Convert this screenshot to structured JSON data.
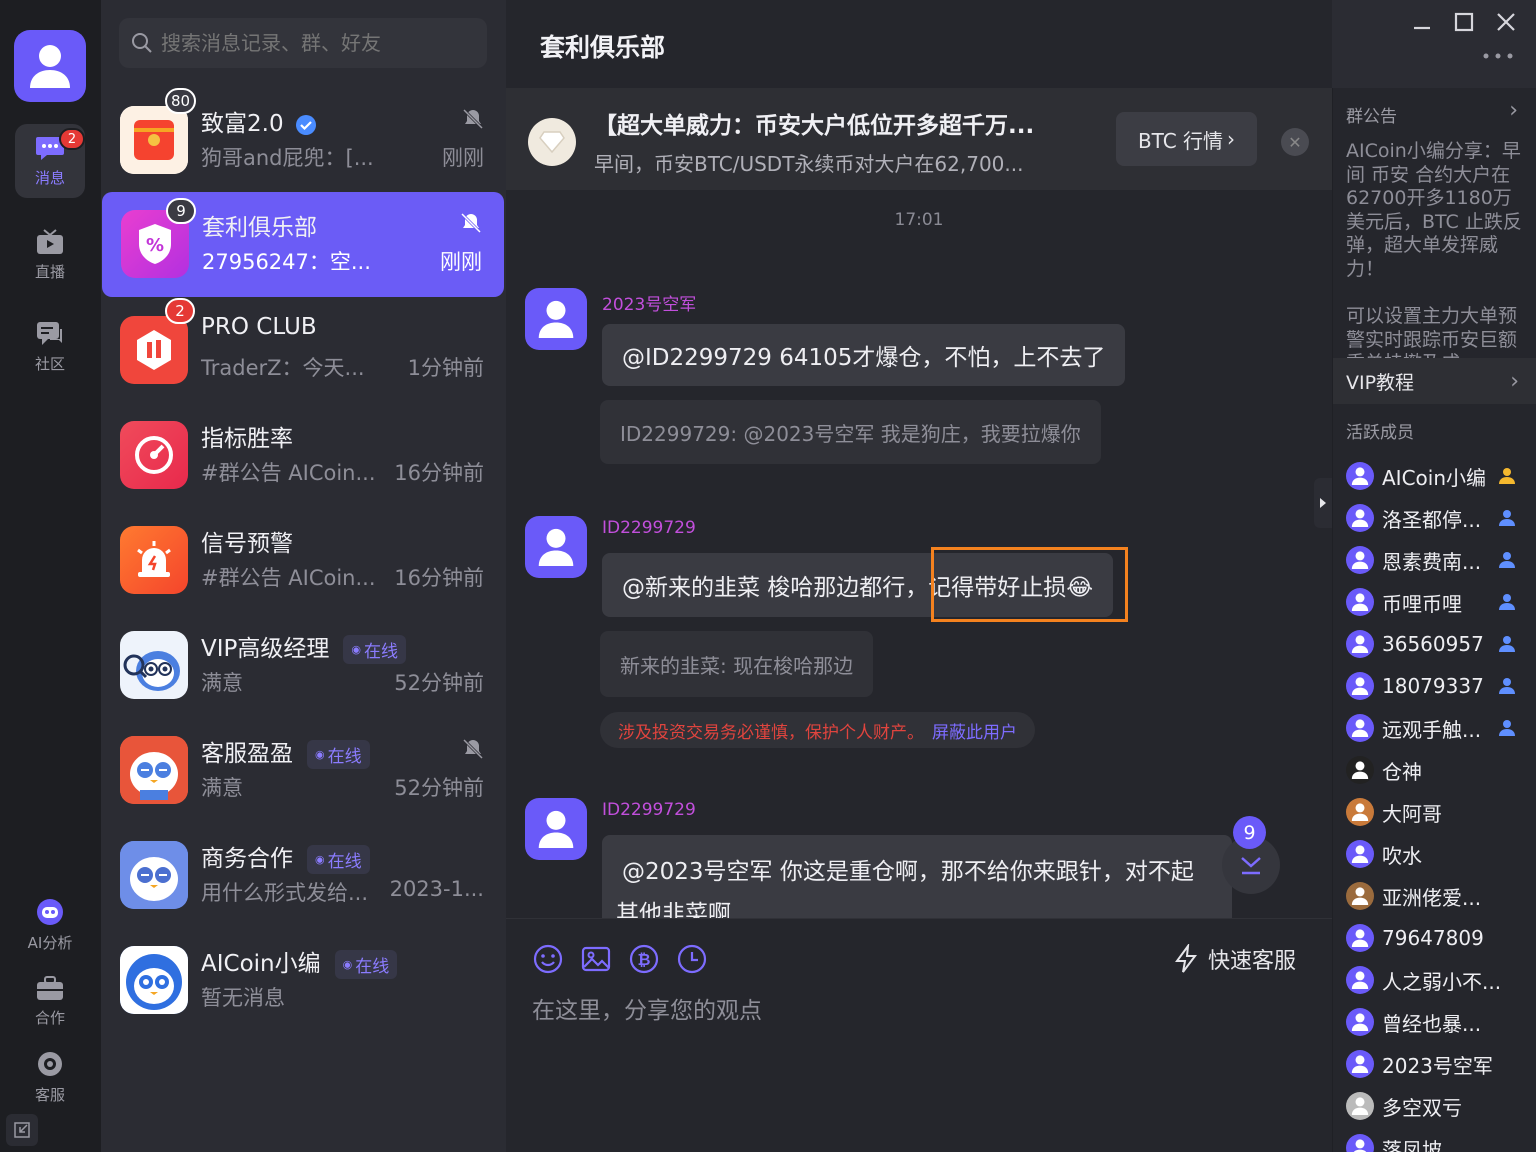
{
  "nav": {
    "items": [
      {
        "label": "消息",
        "badge": "2"
      },
      {
        "label": "直播"
      },
      {
        "label": "社区"
      },
      {
        "label": "AI分析"
      },
      {
        "label": "合作"
      },
      {
        "label": "客服"
      }
    ]
  },
  "search": {
    "placeholder": "搜索消息记录、群、好友"
  },
  "conversations": [
    {
      "name": "致富2.0",
      "preview": "狗哥and屁兜：[...",
      "time": "刚刚",
      "badge": "80",
      "muted": true,
      "verified": true
    },
    {
      "name": "套利俱乐部",
      "preview": "27956247：空...",
      "time": "刚刚",
      "badge": "9",
      "muted": true,
      "active": true
    },
    {
      "name": "PRO CLUB",
      "preview": "TraderZ：今天...",
      "time": "1分钟前",
      "badge": "2"
    },
    {
      "name": "指标胜率",
      "preview": "#群公告 AICoin...",
      "time": "16分钟前"
    },
    {
      "name": "信号预警",
      "preview": "#群公告 AICoin...",
      "time": "16分钟前"
    },
    {
      "name": "VIP高级经理",
      "preview": "满意",
      "time": "52分钟前",
      "online": "在线"
    },
    {
      "name": "客服盈盈",
      "preview": "满意",
      "time": "52分钟前",
      "online": "在线",
      "muted": true
    },
    {
      "name": "商务合作",
      "preview": "用什么形式发给...",
      "time": "2023-1...",
      "online": "在线"
    },
    {
      "name": "AICoin小编",
      "preview": "暂无消息",
      "time": "",
      "online": "在线"
    }
  ],
  "chat": {
    "title": "套利俱乐部",
    "banner": {
      "title": "【超大单威力：币安大户低位开多超千万...",
      "subtitle": "早间，币安BTC/USDT永续币对大户在62,700...",
      "button": "BTC 行情"
    },
    "time_divider": "17:01",
    "messages": [
      {
        "sender": "2023号空军",
        "text": "@ID2299729 64105才爆仓，不怕，上不去了",
        "quote": "ID2299729: @2023号空军 我是狗庄，我要拉爆你"
      },
      {
        "sender": "ID2299729",
        "text": "@新来的韭菜  梭哈那边都行，记得带好止损😂",
        "quote": "新来的韭菜: 现在梭哈那边"
      },
      {
        "sender": "ID2299729",
        "text": "@2023号空军  你这是重仓啊，那不给你来跟针，对不起",
        "text2": "其他韭菜啊"
      }
    ],
    "warning": {
      "text": "涉及投资交易务必谨慎，保护个人财产。",
      "block_link": "屏蔽此用户"
    },
    "unread_count": "9",
    "composer": {
      "placeholder": "在这里，分享您的观点",
      "quick_service": "快速客服"
    }
  },
  "side": {
    "announcement_label": "群公告",
    "announcement_paragraphs": [
      "AICoin小编分享：早间 币安 合约大户在62700开多1180万美元后，BTC 止跌反弹，超大单发挥威力！",
      "可以设置主力大单预警实时跟踪币安巨额委单挂撤及成"
    ],
    "vip_label": "VIP教程",
    "members_label": "活跃成员",
    "members": [
      {
        "name": "AICoin小编",
        "role": "owner"
      },
      {
        "name": "洛圣都停...",
        "role": "admin"
      },
      {
        "name": "恩素费南...",
        "role": "admin"
      },
      {
        "name": "币哩币哩",
        "role": "admin"
      },
      {
        "name": "36560957",
        "role": "admin"
      },
      {
        "name": "18079337",
        "role": "admin"
      },
      {
        "name": "远观手触...",
        "role": "admin"
      },
      {
        "name": "仓神"
      },
      {
        "name": "大阿哥"
      },
      {
        "name": "吹水"
      },
      {
        "name": "亚洲佬爱..."
      },
      {
        "name": "79647809"
      },
      {
        "name": "人之弱小不..."
      },
      {
        "name": "曾经也暴..."
      },
      {
        "name": "2023号空军"
      },
      {
        "name": "多空双亏"
      },
      {
        "name": "落凤坡"
      }
    ]
  },
  "colors": {
    "accent": "#6b5cf6",
    "highlight_border": "#f5821f",
    "warning_text": "#e0443e"
  }
}
